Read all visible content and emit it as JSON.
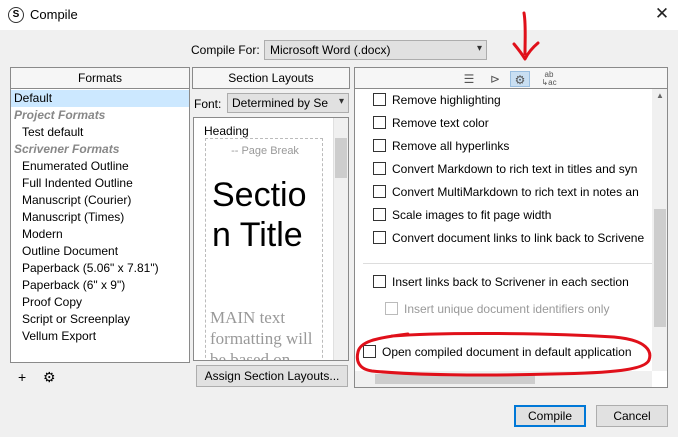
{
  "window": {
    "title": "Compile",
    "close_glyph": "✕",
    "app_icon": "S"
  },
  "compile_for": {
    "label": "Compile For:",
    "value": "Microsoft Word (.docx)"
  },
  "formats": {
    "header": "Formats",
    "items": [
      {
        "kind": "item",
        "label": "Default",
        "selected": true
      },
      {
        "kind": "group",
        "label": "Project Formats"
      },
      {
        "kind": "item",
        "label": "Test default"
      },
      {
        "kind": "group",
        "label": "Scrivener Formats"
      },
      {
        "kind": "item",
        "label": "Enumerated Outline"
      },
      {
        "kind": "item",
        "label": "Full Indented Outline"
      },
      {
        "kind": "item",
        "label": "Manuscript (Courier)"
      },
      {
        "kind": "item",
        "label": "Manuscript (Times)"
      },
      {
        "kind": "item",
        "label": "Modern"
      },
      {
        "kind": "item",
        "label": "Outline Document"
      },
      {
        "kind": "item",
        "label": "Paperback (5.06\" x 7.81\")"
      },
      {
        "kind": "item",
        "label": "Paperback (6\" x 9\")"
      },
      {
        "kind": "item",
        "label": "Proof Copy"
      },
      {
        "kind": "item",
        "label": "Script or Screenplay"
      },
      {
        "kind": "item",
        "label": "Vellum Export"
      }
    ],
    "add_icon": "+",
    "gear_icon": "⚙"
  },
  "section_layouts": {
    "header": "Section Layouts",
    "font_label": "Font:",
    "font_value": "Determined by Se",
    "preview": {
      "heading": "Heading",
      "page_break": "Page Break",
      "title_line1": "Sectio",
      "title_line2": "n Title",
      "main_line1": "MAIN text",
      "main_line2": "formatting will",
      "main_line3": "be based on"
    },
    "assign_button": "Assign Section Layouts..."
  },
  "options": {
    "toolbar": {
      "list_icon": "☰",
      "tag_icon": "⊳",
      "gear_icon": "⚙",
      "replace_icon_top": "ab",
      "replace_icon_bottom": "↳ac"
    },
    "checkboxes": [
      {
        "label": "Remove highlighting",
        "checked": false
      },
      {
        "label": "Remove text color",
        "checked": false
      },
      {
        "label": "Remove all hyperlinks",
        "checked": false
      },
      {
        "label": "Convert Markdown to rich text in titles and syn",
        "checked": false
      },
      {
        "label": "Convert MultiMarkdown to rich text in notes an",
        "checked": false
      },
      {
        "label": "Scale images to fit page width",
        "checked": false
      },
      {
        "label": "Convert document links to link back to Scrivene",
        "checked": false
      },
      {
        "label": "Insert links back to Scrivener in each section",
        "checked": false
      },
      {
        "label": "Insert unique document identifiers only",
        "checked": false,
        "disabled": true
      }
    ],
    "open_compiled": {
      "label": "Open compiled document in default application",
      "checked": false
    }
  },
  "buttons": {
    "compile": "Compile",
    "cancel": "Cancel"
  },
  "annotation_color": "#e0101a",
  "dropdown_arrow": "▾"
}
